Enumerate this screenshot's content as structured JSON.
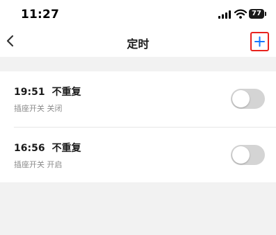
{
  "status_bar": {
    "time": "11:27",
    "battery": "77",
    "icons": [
      "signal-icon",
      "wifi-icon",
      "battery-icon"
    ]
  },
  "nav": {
    "title": "定时",
    "back_icon": "chevron-left-icon",
    "add_icon": "plus-icon",
    "accent_color": "#1677ff",
    "highlight_color": "#e8221d"
  },
  "timers": [
    {
      "time": "19:51",
      "repeat": "不重复",
      "description": "插座开关 关闭",
      "enabled": false
    },
    {
      "time": "16:56",
      "repeat": "不重复",
      "description": "插座开关 开启",
      "enabled": false
    }
  ]
}
